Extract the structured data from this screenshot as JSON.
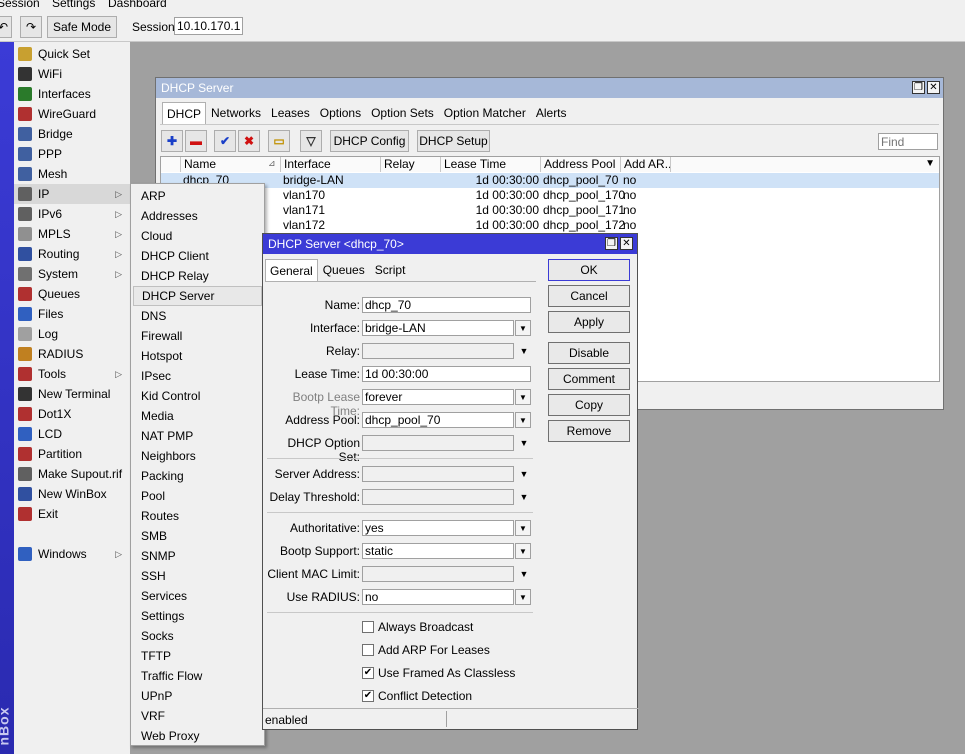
{
  "menubar": [
    "Session",
    "Settings",
    "Dashboard"
  ],
  "toolbar": {
    "safe_mode": "Safe Mode",
    "session_label": "Session:",
    "session_value": "10.10.170.1"
  },
  "sidebar": {
    "brand": "nBox",
    "items": [
      {
        "label": "Quick Set",
        "icon": "quickset-icon"
      },
      {
        "label": "WiFi",
        "icon": "wifi-icon"
      },
      {
        "label": "Interfaces",
        "icon": "interfaces-icon"
      },
      {
        "label": "WireGuard",
        "icon": "wireguard-icon"
      },
      {
        "label": "Bridge",
        "icon": "bridge-icon"
      },
      {
        "label": "PPP",
        "icon": "ppp-icon"
      },
      {
        "label": "Mesh",
        "icon": "mesh-icon"
      },
      {
        "label": "IP",
        "icon": "ip-icon",
        "arrow": true,
        "selected": true
      },
      {
        "label": "IPv6",
        "icon": "ipv6-icon",
        "arrow": true
      },
      {
        "label": "MPLS",
        "icon": "mpls-icon",
        "arrow": true
      },
      {
        "label": "Routing",
        "icon": "routing-icon",
        "arrow": true
      },
      {
        "label": "System",
        "icon": "system-icon",
        "arrow": true
      },
      {
        "label": "Queues",
        "icon": "queues-icon"
      },
      {
        "label": "Files",
        "icon": "files-icon"
      },
      {
        "label": "Log",
        "icon": "log-icon"
      },
      {
        "label": "RADIUS",
        "icon": "radius-icon"
      },
      {
        "label": "Tools",
        "icon": "tools-icon",
        "arrow": true
      },
      {
        "label": "New Terminal",
        "icon": "terminal-icon"
      },
      {
        "label": "Dot1X",
        "icon": "dot1x-icon"
      },
      {
        "label": "LCD",
        "icon": "lcd-icon"
      },
      {
        "label": "Partition",
        "icon": "partition-icon"
      },
      {
        "label": "Make Supout.rif",
        "icon": "supout-icon"
      },
      {
        "label": "New WinBox",
        "icon": "winbox-icon"
      },
      {
        "label": "Exit",
        "icon": "exit-icon"
      },
      {
        "label": "",
        "icon": ""
      },
      {
        "label": "Windows",
        "icon": "windows-icon",
        "arrow": true
      }
    ]
  },
  "ip_submenu": [
    "ARP",
    "Addresses",
    "Cloud",
    "DHCP Client",
    "DHCP Relay",
    "DHCP Server",
    "DNS",
    "Firewall",
    "Hotspot",
    "IPsec",
    "Kid Control",
    "Media",
    "NAT PMP",
    "Neighbors",
    "Packing",
    "Pool",
    "Routes",
    "SMB",
    "SNMP",
    "SSH",
    "Services",
    "Settings",
    "Socks",
    "TFTP",
    "Traffic Flow",
    "UPnP",
    "VRF",
    "Web Proxy"
  ],
  "ip_submenu_selected": "DHCP Server",
  "dhcp_window": {
    "title": "DHCP Server",
    "tabs": [
      "DHCP",
      "Networks",
      "Leases",
      "Options",
      "Option Sets",
      "Option Matcher",
      "Alerts"
    ],
    "active_tab": "DHCP",
    "buttons": {
      "config": "DHCP Config",
      "setup": "DHCP Setup"
    },
    "find_placeholder": "Find",
    "columns": [
      "Name",
      "Interface",
      "Relay",
      "Lease Time",
      "Address Pool",
      "Add AR..."
    ],
    "rows": [
      {
        "name": "dhcp_70",
        "interface": "bridge-LAN",
        "relay": "",
        "lease": "1d 00:30:00",
        "pool": "dhcp_pool_70",
        "add_arp": "no"
      },
      {
        "name": "",
        "interface": "vlan170",
        "relay": "",
        "lease": "1d 00:30:00",
        "pool": "dhcp_pool_170",
        "add_arp": "no"
      },
      {
        "name": "",
        "interface": "vlan171",
        "relay": "",
        "lease": "1d 00:30:00",
        "pool": "dhcp_pool_171",
        "add_arp": "no"
      },
      {
        "name": "",
        "interface": "vlan172",
        "relay": "",
        "lease": "1d 00:30:00",
        "pool": "dhcp_pool_172",
        "add_arp": "no"
      }
    ]
  },
  "edit_dialog": {
    "title": "DHCP Server <dhcp_70>",
    "tabs": [
      "General",
      "Queues",
      "Script"
    ],
    "active_tab": "General",
    "fields": {
      "name": {
        "label": "Name:",
        "value": "dhcp_70"
      },
      "interface": {
        "label": "Interface:",
        "value": "bridge-LAN"
      },
      "relay": {
        "label": "Relay:",
        "value": ""
      },
      "lease_time": {
        "label": "Lease Time:",
        "value": "1d 00:30:00"
      },
      "bootp_lease_time": {
        "label": "Bootp Lease Time:",
        "value": "forever"
      },
      "address_pool": {
        "label": "Address Pool:",
        "value": "dhcp_pool_70"
      },
      "dhcp_option_set": {
        "label": "DHCP Option Set:",
        "value": ""
      },
      "server_address": {
        "label": "Server Address:",
        "value": ""
      },
      "delay_threshold": {
        "label": "Delay Threshold:",
        "value": ""
      },
      "authoritative": {
        "label": "Authoritative:",
        "value": "yes"
      },
      "bootp_support": {
        "label": "Bootp Support:",
        "value": "static"
      },
      "client_mac_limit": {
        "label": "Client MAC Limit:",
        "value": ""
      },
      "use_radius": {
        "label": "Use RADIUS:",
        "value": "no"
      }
    },
    "checkboxes": [
      {
        "label": "Always Broadcast",
        "checked": false
      },
      {
        "label": "Add ARP For Leases",
        "checked": false
      },
      {
        "label": "Use Framed As Classless",
        "checked": true
      },
      {
        "label": "Conflict Detection",
        "checked": true
      }
    ],
    "buttons": [
      "OK",
      "Cancel",
      "Apply",
      "Disable",
      "Comment",
      "Copy",
      "Remove"
    ],
    "status": "enabled"
  },
  "colors": {
    "title_active": "#3b3bd6",
    "title_inactive": "#a6b8d8",
    "selection": "#cfe2f7",
    "sidebar_band": "#3b3bd6"
  }
}
